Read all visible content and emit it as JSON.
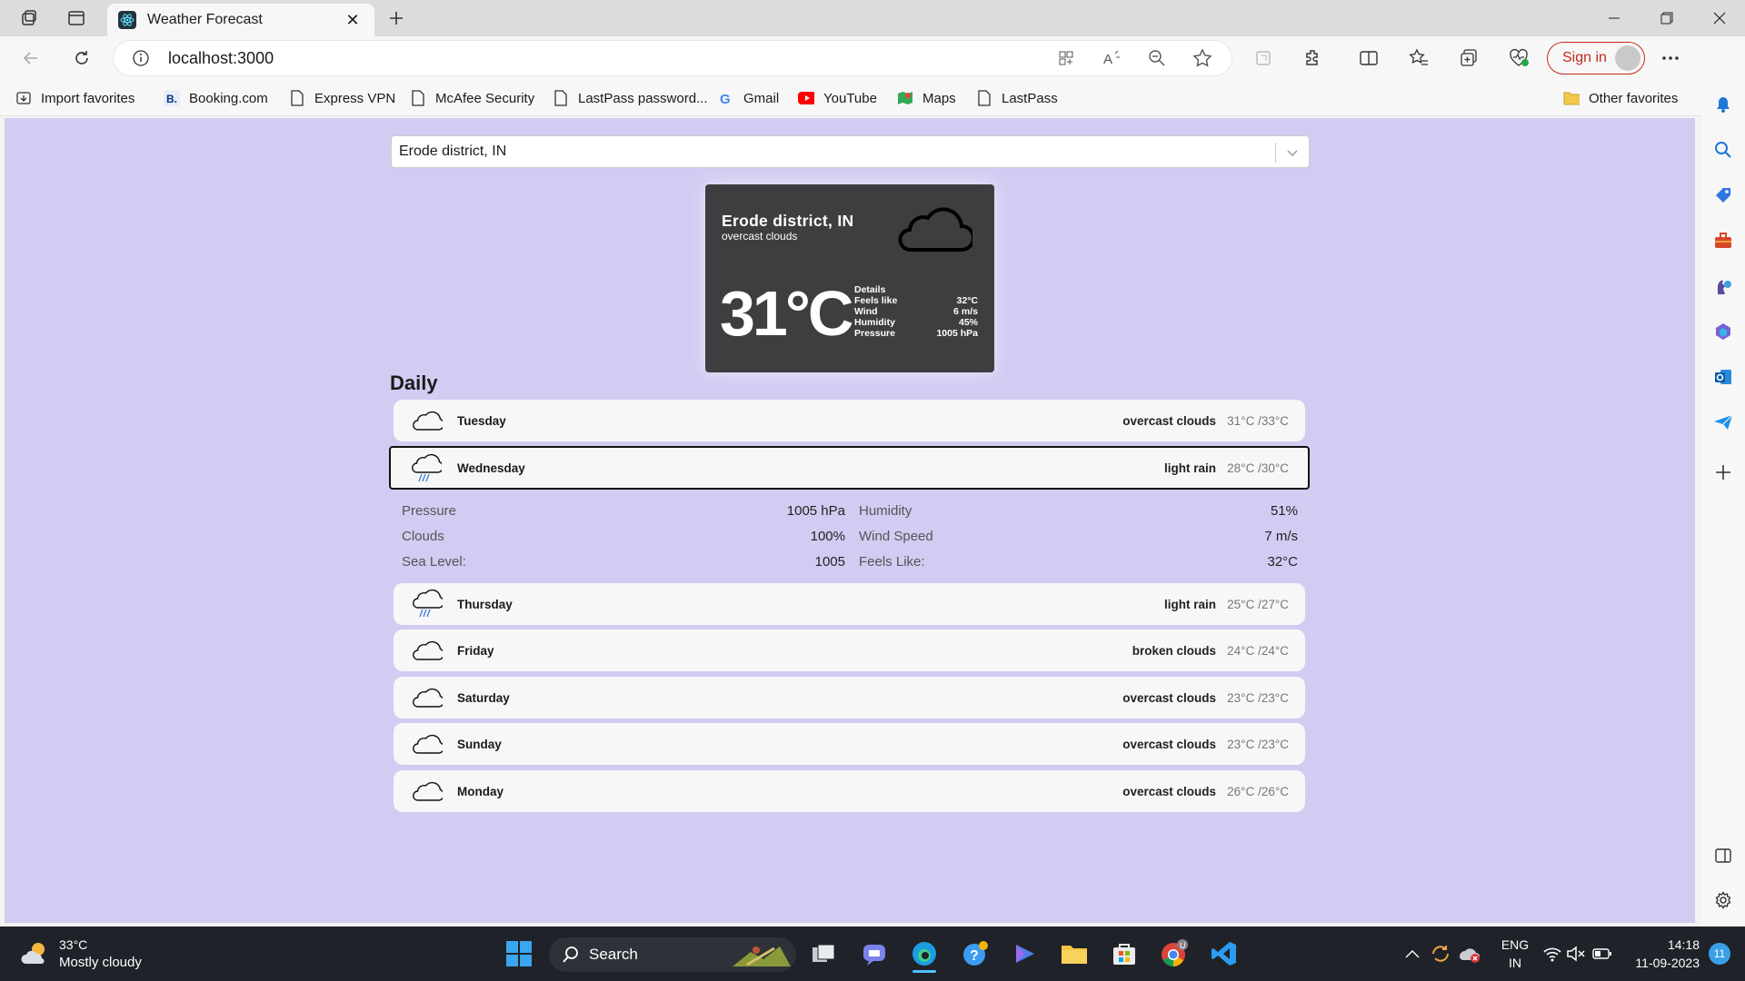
{
  "browser": {
    "tab_title": "Weather Forecast",
    "url": "localhost:3000",
    "sign_in_label": "Sign in",
    "favorites": [
      "Import favorites",
      "Booking.com",
      "Express VPN",
      "McAfee Security",
      "LastPass password...",
      "Gmail",
      "YouTube",
      "Maps",
      "LastPass"
    ],
    "other_favorites": "Other favorites"
  },
  "search": {
    "selected_city": "Erode district, IN"
  },
  "current": {
    "city": "Erode district, IN",
    "description": "overcast clouds",
    "temperature": "31°C",
    "details_label": "Details",
    "details": [
      {
        "label": "Feels like",
        "value": "32°C"
      },
      {
        "label": "Wind",
        "value": "6 m/s"
      },
      {
        "label": "Humidity",
        "value": "45%"
      },
      {
        "label": "Pressure",
        "value": "1005 hPa"
      }
    ]
  },
  "daily": {
    "title": "Daily",
    "days": [
      {
        "day": "Tuesday",
        "description": "overcast clouds",
        "range": "31°C /33°C",
        "icon": "cloud-icon"
      },
      {
        "day": "Wednesday",
        "description": "light rain",
        "range": "28°C /30°C",
        "icon": "rain-cloud-icon"
      },
      {
        "day": "Thursday",
        "description": "light rain",
        "range": "25°C /27°C",
        "icon": "rain-cloud-icon"
      },
      {
        "day": "Friday",
        "description": "broken clouds",
        "range": "24°C /24°C",
        "icon": "cloud-icon"
      },
      {
        "day": "Saturday",
        "description": "overcast clouds",
        "range": "23°C /23°C",
        "icon": "cloud-icon"
      },
      {
        "day": "Sunday",
        "description": "overcast clouds",
        "range": "23°C /23°C",
        "icon": "cloud-icon"
      },
      {
        "day": "Monday",
        "description": "overcast clouds",
        "range": "26°C /26°C",
        "icon": "cloud-icon"
      }
    ],
    "expanded_details": [
      {
        "label": "Pressure",
        "value": "1005 hPa"
      },
      {
        "label": "Humidity",
        "value": "51%"
      },
      {
        "label": "Clouds",
        "value": "100%"
      },
      {
        "label": "Wind Speed",
        "value": "7 m/s"
      },
      {
        "label": "Sea Level:",
        "value": "1005"
      },
      {
        "label": "Feels Like:",
        "value": "32°C"
      }
    ]
  },
  "taskbar": {
    "weather_temp": "33°C",
    "weather_desc": "Mostly cloudy",
    "search_label": "Search",
    "lang": "ENG",
    "region": "IN",
    "time": "14:18",
    "date": "11-09-2023",
    "notification_count": "11",
    "chrome_badge": "U"
  },
  "colors": {
    "page_bg": "#d1ccf2",
    "card_bg": "#3f3d3f",
    "signin_accent": "#c42b1c"
  }
}
